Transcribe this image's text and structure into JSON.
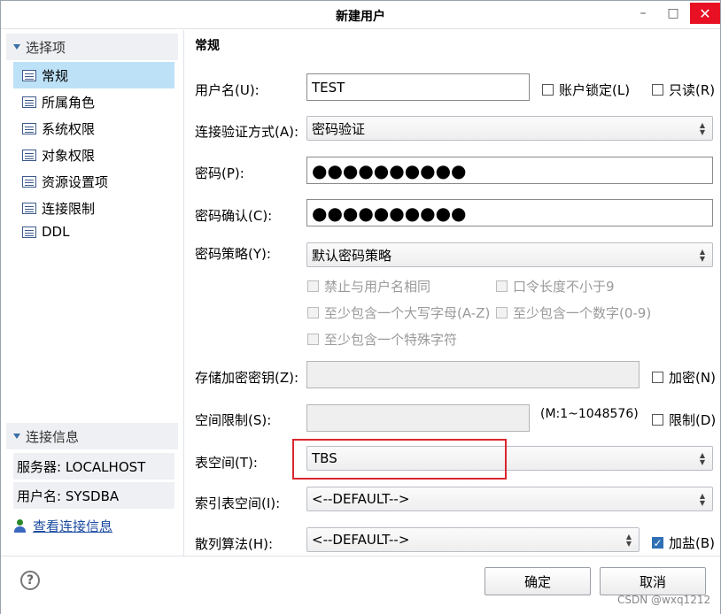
{
  "window": {
    "title": "新建用户",
    "minimize": "–",
    "maximize": "□",
    "close": "✕"
  },
  "sidebar": {
    "options_header": "选择项",
    "items": [
      {
        "label": "常规",
        "selected": true
      },
      {
        "label": "所属角色"
      },
      {
        "label": "系统权限"
      },
      {
        "label": "对象权限"
      },
      {
        "label": "资源设置项"
      },
      {
        "label": "连接限制"
      },
      {
        "label": "DDL"
      }
    ],
    "conn_header": "连接信息",
    "server_label": "服务器: LOCALHOST",
    "user_label": "用户名: SYSDBA",
    "view_conn_link": "查看连接信息"
  },
  "general": {
    "title": "常规",
    "username_label": "用户名(U):",
    "username_value": "TEST",
    "lock_label": "账户锁定(L)",
    "readonly_label": "只读(R)",
    "auth_label": "连接验证方式(A):",
    "auth_value": "密码验证",
    "password_label": "密码(P):",
    "password_value": "●●●●●●●●●●",
    "confirm_label": "密码确认(C):",
    "confirm_value": "●●●●●●●●●●",
    "policy_label": "密码策略(Y):",
    "policy_value": "默认密码策略",
    "policy_options": [
      "禁止与用户名相同",
      "口令长度不小于9",
      "至少包含一个大写字母(A-Z)",
      "至少包含一个数字(0-9)",
      "至少包含一个特殊字符"
    ],
    "storage_key_label": "存储加密密钥(Z):",
    "encrypt_label": "加密(N)",
    "space_label": "空间限制(S):",
    "space_hint": "(M:1~1048576)",
    "limit_label": "限制(D)",
    "tablespace_label": "表空间(T):",
    "tablespace_value": "TBS",
    "index_ts_label": "索引表空间(I):",
    "index_ts_value": "<--DEFAULT-->",
    "hash_label": "散列算法(H):",
    "hash_value": "<--DEFAULT-->",
    "salt_label": "加盐(B)"
  },
  "footer": {
    "help": "?",
    "ok": "确定",
    "cancel": "取消",
    "watermark": "CSDN @wxq1212"
  }
}
